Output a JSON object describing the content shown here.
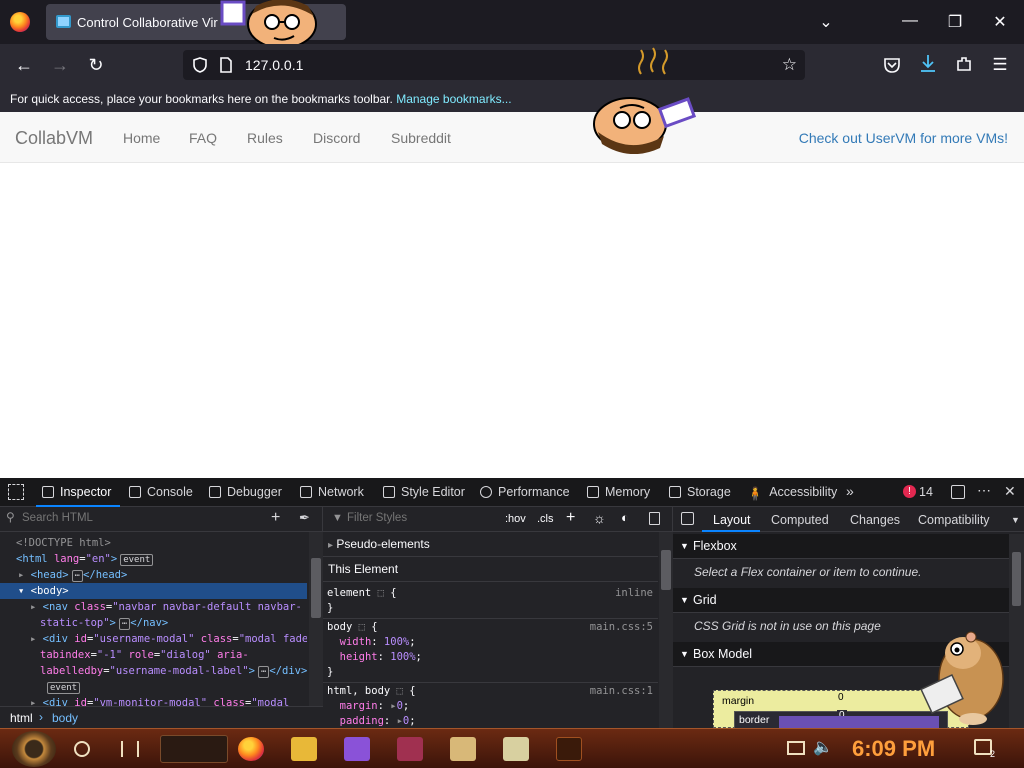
{
  "browser": {
    "tab_title": "Control Collaborative Vir",
    "url": "127.0.0.1",
    "bookmarks_text": "For quick access, place your bookmarks here on the bookmarks toolbar.",
    "bookmarks_link": "Manage bookmarks..."
  },
  "site": {
    "brand": "CollabVM",
    "nav": [
      "Home",
      "FAQ",
      "Rules",
      "Discord",
      "Subreddit"
    ],
    "right_link": "Check out UserVM for more VMs!"
  },
  "devtools": {
    "tabs": [
      "Inspector",
      "Console",
      "Debugger",
      "Network",
      "Style Editor",
      "Performance",
      "Memory",
      "Storage",
      "Accessibility"
    ],
    "error_count": "14",
    "search_placeholder": "Search HTML",
    "filter_placeholder": "Filter Styles",
    "hov": ":hov",
    "cls": ".cls",
    "breadcrumb": [
      "html",
      "body"
    ],
    "tree": {
      "doctype": "<!DOCTYPE html>",
      "html_open": "html",
      "lang_attr": "lang",
      "lang_val": "\"en\"",
      "head": "head",
      "body": "body",
      "nav_tag": "nav",
      "nav_class": "\"navbar navbar-default navbar-",
      "nav_class2": "static-top\"",
      "div1_id": "\"username-modal\"",
      "div1_class": "\"modal fade\"",
      "div1_tabindex": "\"-1\"",
      "div1_role": "\"dialog\"",
      "div1_aria": "aria-",
      "div1_labelledby": "\"username-modal-label\"",
      "div2_id": "\"vm-monitor-modal\"",
      "div2_class": "\"modal",
      "event": "event"
    },
    "styles": {
      "pseudo": "Pseudo-elements",
      "this_element": "This Element",
      "element_sel": "element",
      "inline": "inline",
      "body_sel": "body",
      "main5": "main.css:5",
      "width": "width",
      "width_val": "100%",
      "height": "height",
      "height_val": "100%",
      "html_body_sel": "html, body",
      "main1": "main.css:1",
      "margin": "margin",
      "margin_val": "0",
      "padding": "padding",
      "padding_val": "0"
    },
    "layout_tabs": [
      "Layout",
      "Computed",
      "Changes",
      "Compatibility"
    ],
    "flexbox_hdr": "Flexbox",
    "flexbox_msg": "Select a Flex container or item to continue.",
    "grid_hdr": "Grid",
    "grid_msg": "CSS Grid is not in use on this page",
    "boxmodel_hdr": "Box Model",
    "bm_margin": "margin",
    "bm_border": "border",
    "bm_zero": "0"
  },
  "taskbar": {
    "time": "6:09 PM",
    "notifications": "2"
  }
}
